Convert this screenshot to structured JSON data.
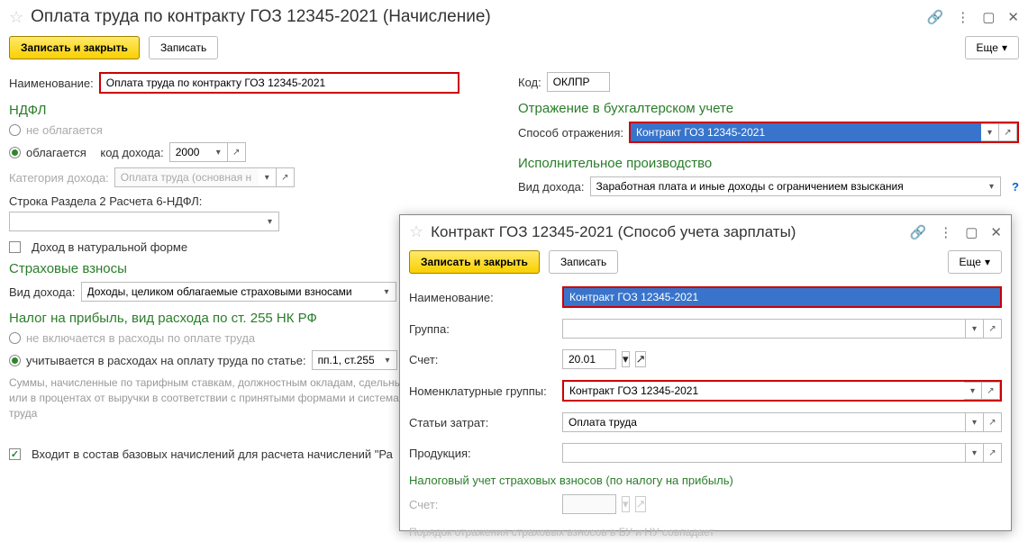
{
  "main": {
    "title": "Оплата труда по контракту ГОЗ 12345-2021 (Начисление)",
    "save_close": "Записать и закрыть",
    "save": "Записать",
    "more": "Еще",
    "name_label": "Наименование:",
    "name_value": "Оплата труда по контракту ГОЗ 12345-2021",
    "code_label": "Код:",
    "code_value": "ОКЛПР",
    "ndfl": {
      "header": "НДФЛ",
      "not_taxed": "не облагается",
      "taxed": "облагается",
      "income_code_label": "код дохода:",
      "income_code": "2000",
      "cat_label": "Категория дохода:",
      "cat_value": "Оплата труда (основная н",
      "section2_label": "Строка Раздела 2 Расчета 6-НДФЛ:",
      "natural": "Доход в натуральной форме"
    },
    "insurance": {
      "header": "Страховые взносы",
      "type_label": "Вид дохода:",
      "type_value": "Доходы, целиком облагаемые страховыми взносами"
    },
    "profit": {
      "header": "Налог на прибыль, вид расхода по ст. 255 НК РФ",
      "not_included": "не включается в расходы по оплате труда",
      "included": "учитывается в расходах на оплату труда по статье:",
      "article": "пп.1, ст.255",
      "note": "Суммы, начисленные по тарифным ставкам, должностным окладам, сдельным расценкам или в процентах от выручки в соответствии с принятыми формами и системами оплаты труда"
    },
    "base_acc": "Входит в состав базовых начислений для расчета начислений \"Ра",
    "accounting": {
      "header": "Отражение в бухгалтерском учете",
      "method_label": "Способ отражения:",
      "method_value": "Контракт ГОЗ 12345-2021"
    },
    "exec": {
      "header": "Исполнительное производство",
      "type_label": "Вид дохода:",
      "type_value": "Заработная плата и иные доходы с ограничением взыскания"
    }
  },
  "dialog": {
    "title": "Контракт ГОЗ 12345-2021 (Способ учета зарплаты)",
    "save_close": "Записать и закрыть",
    "save": "Записать",
    "more": "Еще",
    "name_label": "Наименование:",
    "name_value": "Контракт ГОЗ 12345-2021",
    "group_label": "Группа:",
    "account_label": "Счет:",
    "account_value": "20.01",
    "nomen_label": "Номенклатурные группы:",
    "nomen_value": "Контракт ГОЗ 12345-2021",
    "cost_label": "Статьи затрат:",
    "cost_value": "Оплата труда",
    "product_label": "Продукция:",
    "tax_section": "Налоговый учет страховых взносов (по налогу на прибыль)",
    "tax_account_label": "Счет:",
    "footer_note": "Порядок отражения страховых взносов в БУ и НУ совпадает"
  }
}
